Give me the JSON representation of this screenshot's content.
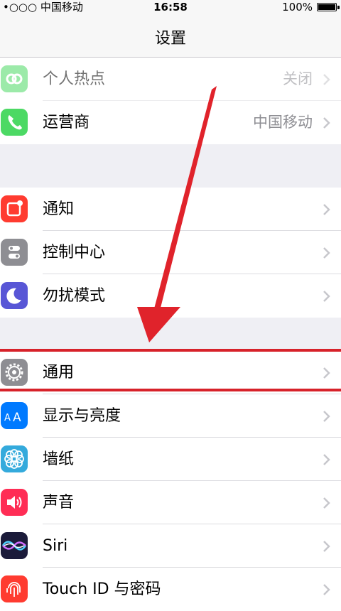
{
  "status_bar": {
    "carrier": "•○○○ 中国移动",
    "time": "16:58",
    "battery": "100%"
  },
  "nav": {
    "title": "设置"
  },
  "groups": [
    {
      "rows": [
        {
          "label": "个人热点",
          "value": "关闭",
          "icon": "hotspot-icon",
          "color": "#4cd964"
        },
        {
          "label": "运营商",
          "value": "中国移动",
          "icon": "phone-icon",
          "color": "#4cd964"
        }
      ]
    },
    {
      "rows": [
        {
          "label": "通知",
          "icon": "notifications-icon",
          "color": "#ff3b30"
        },
        {
          "label": "控制中心",
          "icon": "control-center-icon",
          "color": "#8e8e93"
        },
        {
          "label": "勿扰模式",
          "icon": "moon-icon",
          "color": "#5856d6"
        }
      ]
    },
    {
      "rows": [
        {
          "label": "通用",
          "icon": "gear-icon",
          "color": "#8e8e93"
        },
        {
          "label": "显示与亮度",
          "icon": "display-icon",
          "color": "#007aff"
        },
        {
          "label": "墙纸",
          "icon": "wallpaper-icon",
          "color": "#34aadc"
        },
        {
          "label": "声音",
          "icon": "speaker-icon",
          "color": "#ff2d55"
        },
        {
          "label": "Siri",
          "icon": "siri-icon",
          "color": "#1b1b3a"
        },
        {
          "label": "Touch ID 与密码",
          "icon": "fingerprint-icon",
          "color": "#ff3b30"
        }
      ]
    }
  ],
  "annotation": {
    "highlight_color": "#d7222a"
  }
}
